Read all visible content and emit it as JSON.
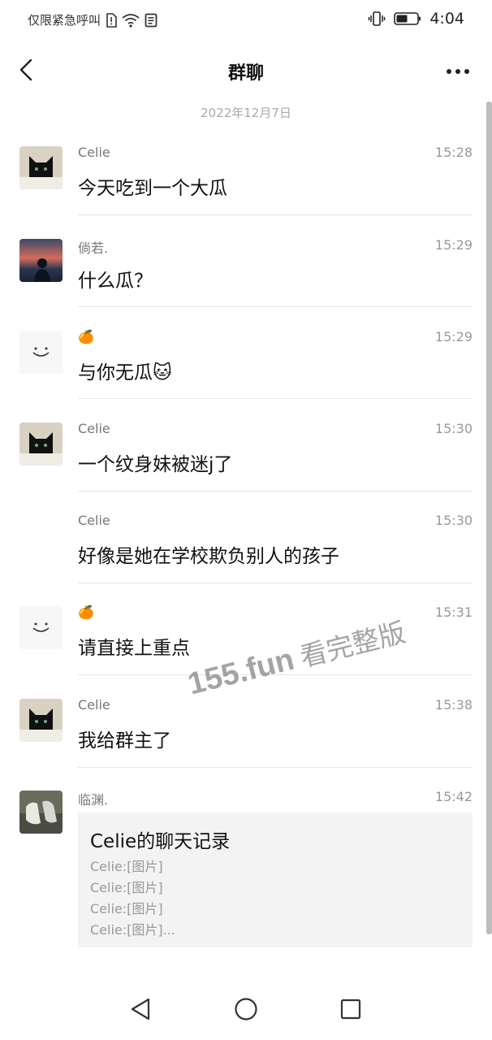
{
  "status_bar": {
    "carrier_text": "仅限紧急呼叫",
    "time": "4:04"
  },
  "header": {
    "title": "群聊",
    "back_icon": "chevron-left-icon",
    "more_icon": "more-horizontal-icon"
  },
  "date_divider": "2022年12月7日",
  "messages": [
    {
      "sender": "Celie",
      "time": "15:28",
      "text": "今天吃到一个大瓜",
      "avatar": "black-cat"
    },
    {
      "sender": "倘若.",
      "time": "15:29",
      "text": "什么瓜？",
      "avatar": "sunset-person"
    },
    {
      "sender": "🍊",
      "time": "15:29",
      "text": "与你无瓜🐱",
      "avatar": "smiley-face"
    },
    {
      "sender": "Celie",
      "time": "15:30",
      "text": "一个纹身妹被迷j了",
      "avatar": "black-cat"
    },
    {
      "sender": "Celie",
      "time": "15:30",
      "text": "好像是她在学校欺负别人的孩子",
      "avatar": "none"
    },
    {
      "sender": "🍊",
      "time": "15:31",
      "text": "请直接上重点",
      "avatar": "smiley-face"
    },
    {
      "sender": "Celie",
      "time": "15:38",
      "text": "我给群主了",
      "avatar": "black-cat"
    },
    {
      "sender": "临渊.",
      "time": "15:42",
      "text": "",
      "avatar": "sneakers-photo"
    }
  ],
  "chat_record": {
    "title": "Celie的聊天记录",
    "lines": [
      "Celie:[图片]",
      "Celie:[图片]",
      "Celie:[图片]",
      "Celie:[图片]..."
    ]
  },
  "watermark": {
    "part1": "155.fun",
    "part2": " 看完整版"
  },
  "nav_bar": {
    "back_icon": "triangle-back-icon",
    "home_icon": "circle-home-icon",
    "recents_icon": "square-recents-icon"
  }
}
